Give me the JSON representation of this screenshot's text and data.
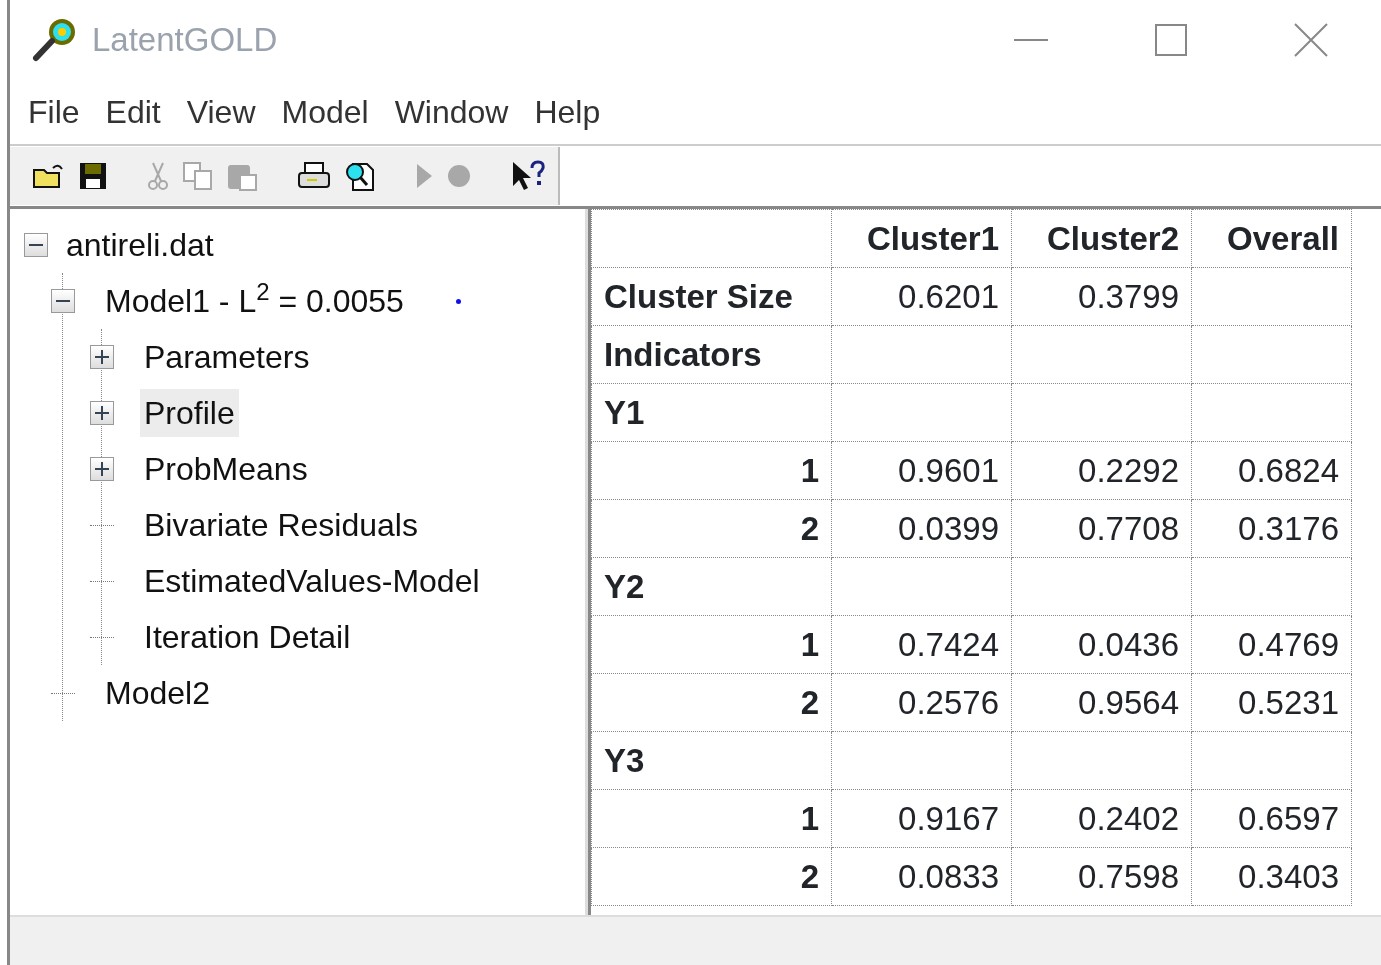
{
  "window": {
    "title": "LatentGOLD"
  },
  "menu": [
    "File",
    "Edit",
    "View",
    "Model",
    "Window",
    "Help"
  ],
  "toolbar": [
    {
      "kind": "open",
      "disabled": false
    },
    {
      "kind": "save",
      "disabled": false
    },
    {
      "kind": "sep"
    },
    {
      "kind": "cut",
      "disabled": true
    },
    {
      "kind": "copy",
      "disabled": true
    },
    {
      "kind": "paste",
      "disabled": true
    },
    {
      "kind": "sep"
    },
    {
      "kind": "print",
      "disabled": false
    },
    {
      "kind": "preview",
      "disabled": false
    },
    {
      "kind": "sep"
    },
    {
      "kind": "run",
      "disabled": true
    },
    {
      "kind": "stop",
      "disabled": true
    },
    {
      "kind": "sep"
    },
    {
      "kind": "help",
      "disabled": false
    }
  ],
  "tree": [
    {
      "label": "antireli.dat",
      "expanded": true,
      "selected": false,
      "children": [
        {
          "label": "Model1 - L$^{2}$ = 0.0055",
          "expanded": true,
          "selected": false,
          "marker": true,
          "children": [
            {
              "label": "Parameters",
              "expanded": false,
              "selected": false
            },
            {
              "label": "Profile",
              "expanded": false,
              "selected": true
            },
            {
              "label": "ProbMeans",
              "expanded": false,
              "selected": false
            },
            {
              "label": "Bivariate Residuals",
              "selected": false
            },
            {
              "label": "EstimatedValues-Model",
              "selected": false
            },
            {
              "label": "Iteration Detail",
              "selected": false
            }
          ]
        },
        {
          "label": "Model2",
          "selected": false
        }
      ]
    }
  ],
  "table": {
    "columns": [
      "Cluster1",
      "Cluster2",
      "Overall"
    ],
    "rows": [
      {
        "kind": "group",
        "label": "Cluster Size",
        "values": [
          "0.6201",
          "0.3799"
        ]
      },
      {
        "kind": "group",
        "label": "Indicators"
      },
      {
        "kind": "group",
        "label": "Y1"
      },
      {
        "kind": "level",
        "label": "1",
        "values": [
          "0.9601",
          "0.2292",
          "0.6824"
        ]
      },
      {
        "kind": "level",
        "label": "2",
        "values": [
          "0.0399",
          "0.7708",
          "0.3176"
        ]
      },
      {
        "kind": "group",
        "label": "Y2"
      },
      {
        "kind": "level",
        "label": "1",
        "values": [
          "0.7424",
          "0.0436",
          "0.4769"
        ]
      },
      {
        "kind": "level",
        "label": "2",
        "values": [
          "0.2576",
          "0.9564",
          "0.5231"
        ]
      },
      {
        "kind": "group",
        "label": "Y3"
      },
      {
        "kind": "level",
        "label": "1",
        "values": [
          "0.9167",
          "0.2402",
          "0.6597"
        ]
      },
      {
        "kind": "level",
        "label": "2",
        "values": [
          "0.0833",
          "0.7598",
          "0.3403"
        ]
      }
    ]
  }
}
